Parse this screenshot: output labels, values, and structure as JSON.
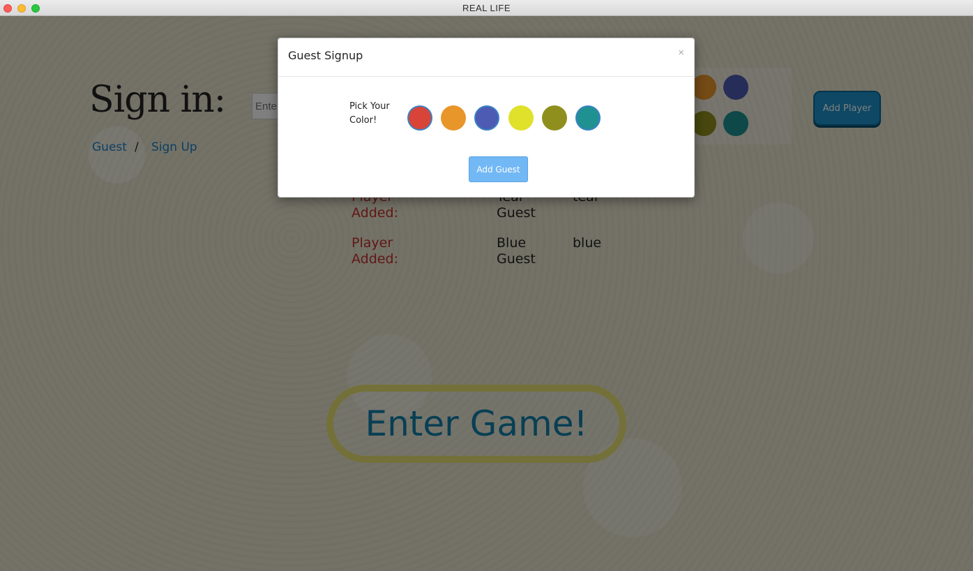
{
  "window": {
    "title": "REAL LIFE"
  },
  "signin": {
    "title": "Sign in:",
    "guest_link": "Guest",
    "separator": "/",
    "signup_link": "Sign Up",
    "name_input_placeholder": "Enter",
    "add_player_label": "Add Player"
  },
  "players": [
    {
      "label": "Player Added:",
      "name": "Teal Guest",
      "color": "teal"
    },
    {
      "label": "Player Added:",
      "name": "Blue Guest",
      "color": "blue"
    }
  ],
  "enter_game_label": "Enter Game!",
  "modal": {
    "title": "Guest Signup",
    "close_label": "×",
    "pick_label": "Pick Your Color!",
    "colors": [
      {
        "name": "red",
        "hex": "#d84437",
        "selected": true
      },
      {
        "name": "orange",
        "hex": "#e8952a",
        "selected": false
      },
      {
        "name": "blue",
        "hex": "#4d5bb3",
        "selected": true
      },
      {
        "name": "yellow",
        "hex": "#dfe12a",
        "selected": false
      },
      {
        "name": "olive",
        "hex": "#8f8f1e",
        "selected": false
      },
      {
        "name": "teal",
        "hex": "#1f9191",
        "selected": true
      }
    ],
    "add_guest_label": "Add Guest"
  }
}
